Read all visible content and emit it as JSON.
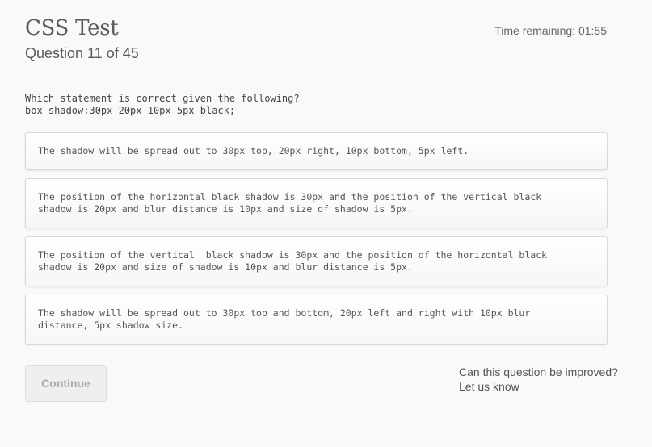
{
  "header": {
    "title": "CSS Test",
    "question_counter": "Question 11 of 45",
    "timer": "Time remaining: 01:55"
  },
  "question": {
    "prompt": "Which statement is correct given the following?",
    "code": "box-shadow:30px 20px 10px 5px black;"
  },
  "answers": [
    {
      "text": "The shadow will be spread out to 30px top, 20px right, 10px bottom, 5px left."
    },
    {
      "text": "The position of the horizontal black shadow is 30px and the position of the vertical black\nshadow is 20px and blur distance is 10px and size of shadow is 5px."
    },
    {
      "text": "The position of the vertical  black shadow is 30px and the position of the horizontal black\nshadow is 20px and size of shadow is 10px and blur distance is 5px."
    },
    {
      "text": "The shadow will be spread out to 30px top and bottom, 20px left and right with 10px blur\ndistance, 5px shadow size."
    }
  ],
  "actions": {
    "continue_label": "Continue"
  },
  "feedback": {
    "question_text": "Can this question be improved?",
    "link_text": "Let us know"
  }
}
